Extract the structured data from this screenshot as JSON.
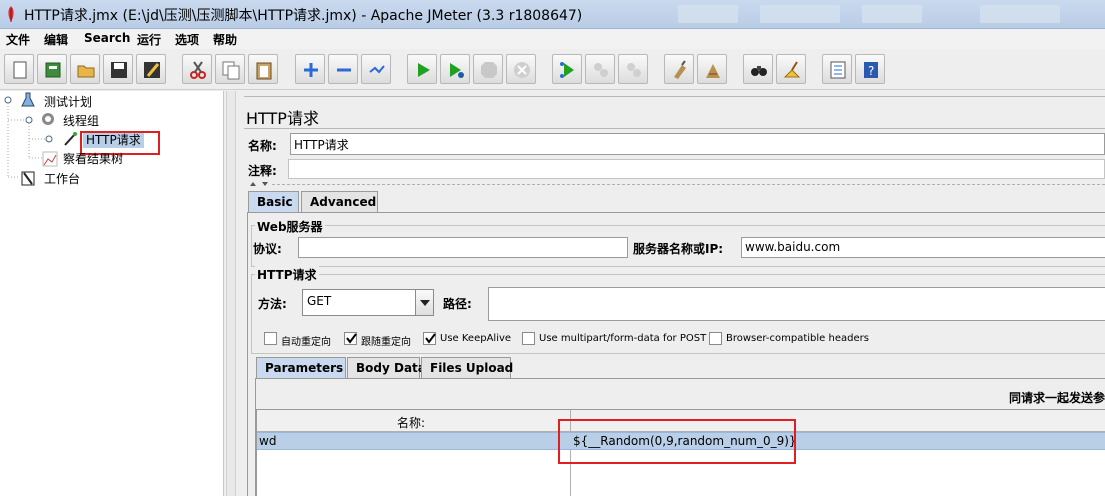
{
  "window": {
    "title": "HTTP请求.jmx (E:\\jd\\压测\\压测脚本\\HTTP请求.jmx) - Apache JMeter (3.3 r1808647)"
  },
  "menu": [
    "文件",
    "编辑",
    "Search",
    "运行",
    "选项",
    "帮助"
  ],
  "toolbar_icons": [
    "new-icon",
    "templates-icon",
    "open-icon",
    "save-icon",
    "save-as-icon",
    "cut-icon",
    "copy-icon",
    "paste-icon",
    "expand-icon",
    "collapse-icon",
    "toggle-icon",
    "start-icon",
    "start-no-pause-icon",
    "stop-icon",
    "shutdown-icon",
    "remote-start-icon",
    "remote-stop-icon",
    "remote-shutdown-icon",
    "clear-icon",
    "clear-all-icon",
    "search-icon",
    "reset-search-icon",
    "function-helper-icon",
    "help-icon"
  ],
  "tree": {
    "test_plan": "测试计划",
    "thread_group": "线程组",
    "http_request": "HTTP请求",
    "results_tree": "察看结果树",
    "workbench": "工作台"
  },
  "panel": {
    "title": "HTTP请求",
    "name_label": "名称:",
    "name_value": "HTTP请求",
    "comment_label": "注释:",
    "comment_value": "",
    "tabs": [
      "Basic",
      "Advanced"
    ],
    "web_server": {
      "group_title": "Web服务器",
      "protocol_label": "协议:",
      "protocol_value": "",
      "server_label": "服务器名称或IP:",
      "server_value": "www.baidu.com"
    },
    "http_request": {
      "group_title": "HTTP请求",
      "method_label": "方法:",
      "method_value": "GET",
      "path_label": "路径:",
      "path_value": ""
    },
    "checkboxes": [
      {
        "label": "自动重定向",
        "checked": false
      },
      {
        "label": "跟随重定向",
        "checked": true
      },
      {
        "label": "Use KeepAlive",
        "checked": true
      },
      {
        "label": "Use multipart/form-data for POST",
        "checked": false
      },
      {
        "label": "Browser-compatible headers",
        "checked": false
      }
    ],
    "sub_tabs": [
      "Parameters",
      "Body Data",
      "Files Upload"
    ],
    "params": {
      "header_right": "同请求一起发送参",
      "col_name": "名称:",
      "rows": [
        {
          "name": "wd",
          "value": "${__Random(0,9,random_num_0_9)}"
        }
      ]
    }
  }
}
